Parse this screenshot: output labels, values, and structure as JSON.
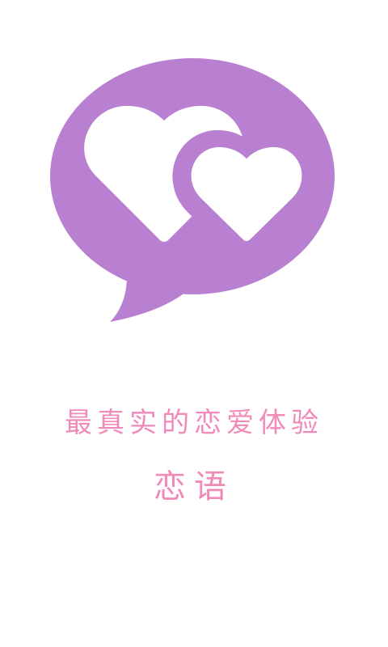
{
  "splash": {
    "tagline": "最真实的恋爱体验",
    "app_name": "恋语",
    "logo_icon": "speech-bubble-hearts-icon"
  },
  "colors": {
    "background": "#ffffff",
    "bubble": "#b97fd0",
    "hearts": "#ffffff",
    "text_pink": "#f08ab8"
  }
}
